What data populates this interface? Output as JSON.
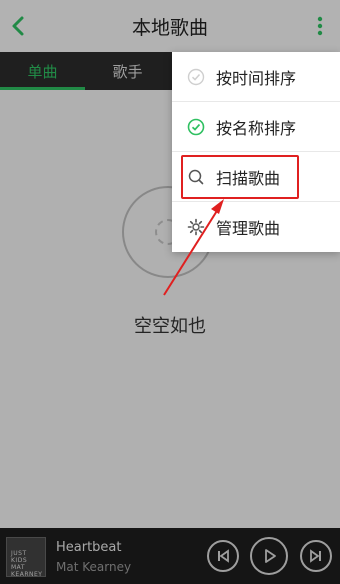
{
  "header": {
    "title": "本地歌曲",
    "back_icon": "chevron-left-icon",
    "more_icon": "more-vertical-icon"
  },
  "tabs": [
    {
      "label": "单曲",
      "active": true
    },
    {
      "label": "歌手",
      "active": false
    }
  ],
  "content": {
    "empty_text": "空空如也"
  },
  "menu": {
    "items": [
      {
        "label": "按时间排序",
        "icon": "check-circle-icon",
        "checked": false
      },
      {
        "label": "按名称排序",
        "icon": "check-circle-icon",
        "checked": true
      },
      {
        "label": "扫描歌曲",
        "icon": "search-icon",
        "highlighted": true
      },
      {
        "label": "管理歌曲",
        "icon": "gear-icon"
      }
    ]
  },
  "player": {
    "title": "Heartbeat",
    "artist": "Mat Kearney",
    "cover_text": "JUST KIDS MAT KEARNEY",
    "controls": [
      "prev-icon",
      "play-icon",
      "next-icon"
    ]
  },
  "colors": {
    "accent": "#2fc061",
    "highlight": "#e02020",
    "tabs_bg": "#2c2c2c",
    "player_bg": "#1e1e1e"
  }
}
